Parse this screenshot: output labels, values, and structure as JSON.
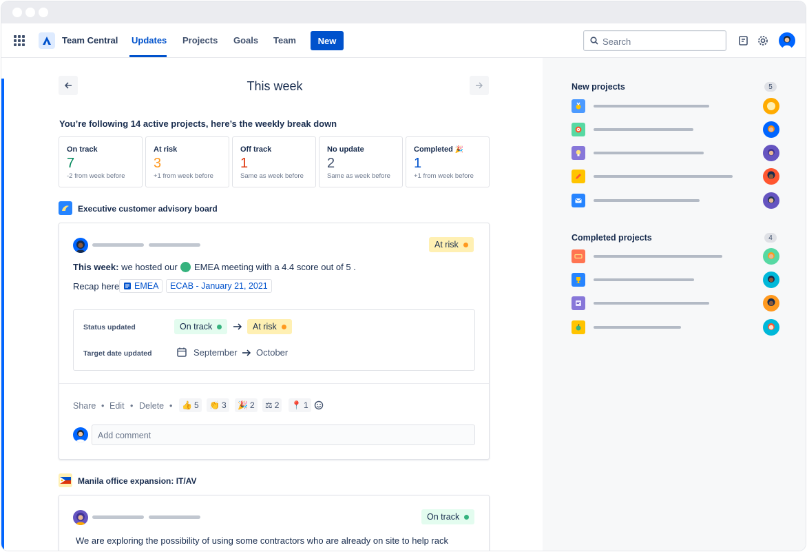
{
  "nav": {
    "brand": "Team Central",
    "items": [
      "Updates",
      "Projects",
      "Goals",
      "Team"
    ],
    "new_label": "New",
    "search_placeholder": "Search"
  },
  "week": {
    "title": "This week"
  },
  "summary": "You’re following 14 active projects, here’s the weekly break down",
  "stats": [
    {
      "label": "On track",
      "value": "7",
      "sub": "-2 from week before",
      "color": "#00875A"
    },
    {
      "label": "At risk",
      "value": "3",
      "sub": "+1 from week before",
      "color": "#FF991F"
    },
    {
      "label": "Off track",
      "value": "1",
      "sub": "Same as week before",
      "color": "#DE350B"
    },
    {
      "label": "No update",
      "value": "2",
      "sub": "Same as week before",
      "color": "#42526E"
    },
    {
      "label": "Completed",
      "value": "1",
      "sub": "+1 from week before",
      "color": "#0052CC"
    }
  ],
  "projects": [
    {
      "name": "Executive customer advisory board",
      "status": "At risk",
      "update": {
        "lead": "This week:",
        "text_before": " we hosted our",
        "text_after": "EMEA meeting with a 4.4 score out of 5 .",
        "recap_label": "Recap here:",
        "link1": "EMEA",
        "link2": "ECAB - January 21, 2021"
      },
      "changes": {
        "status_label": "Status updated",
        "from_status": "On track",
        "to_status": "At risk",
        "date_label": "Target date updated",
        "from_date": "September",
        "to_date": "October"
      },
      "actions": {
        "share": "Share",
        "edit": "Edit",
        "delete": "Delete",
        "sep": "•"
      },
      "reactions": [
        {
          "icon": "thumbs-up-icon",
          "count": "5"
        },
        {
          "icon": "clap-icon",
          "count": "3"
        },
        {
          "icon": "party-icon",
          "count": "2"
        },
        {
          "icon": "scales-icon",
          "count": "2"
        },
        {
          "icon": "pin-icon",
          "count": "1"
        }
      ],
      "comment_placeholder": "Add comment"
    },
    {
      "name": "Manila office expansion: IT/AV",
      "status": "On track",
      "update_text": "We are exploring the possibility of using some contractors who are already on site to help rack"
    }
  ],
  "sidebar": {
    "new_title": "New projects",
    "new_count": "5",
    "completed_title": "Completed projects",
    "completed_count": "4"
  },
  "colors": {
    "brand_blue": "#0052CC",
    "on_track": "#36B37E",
    "at_risk": "#FF991F"
  }
}
